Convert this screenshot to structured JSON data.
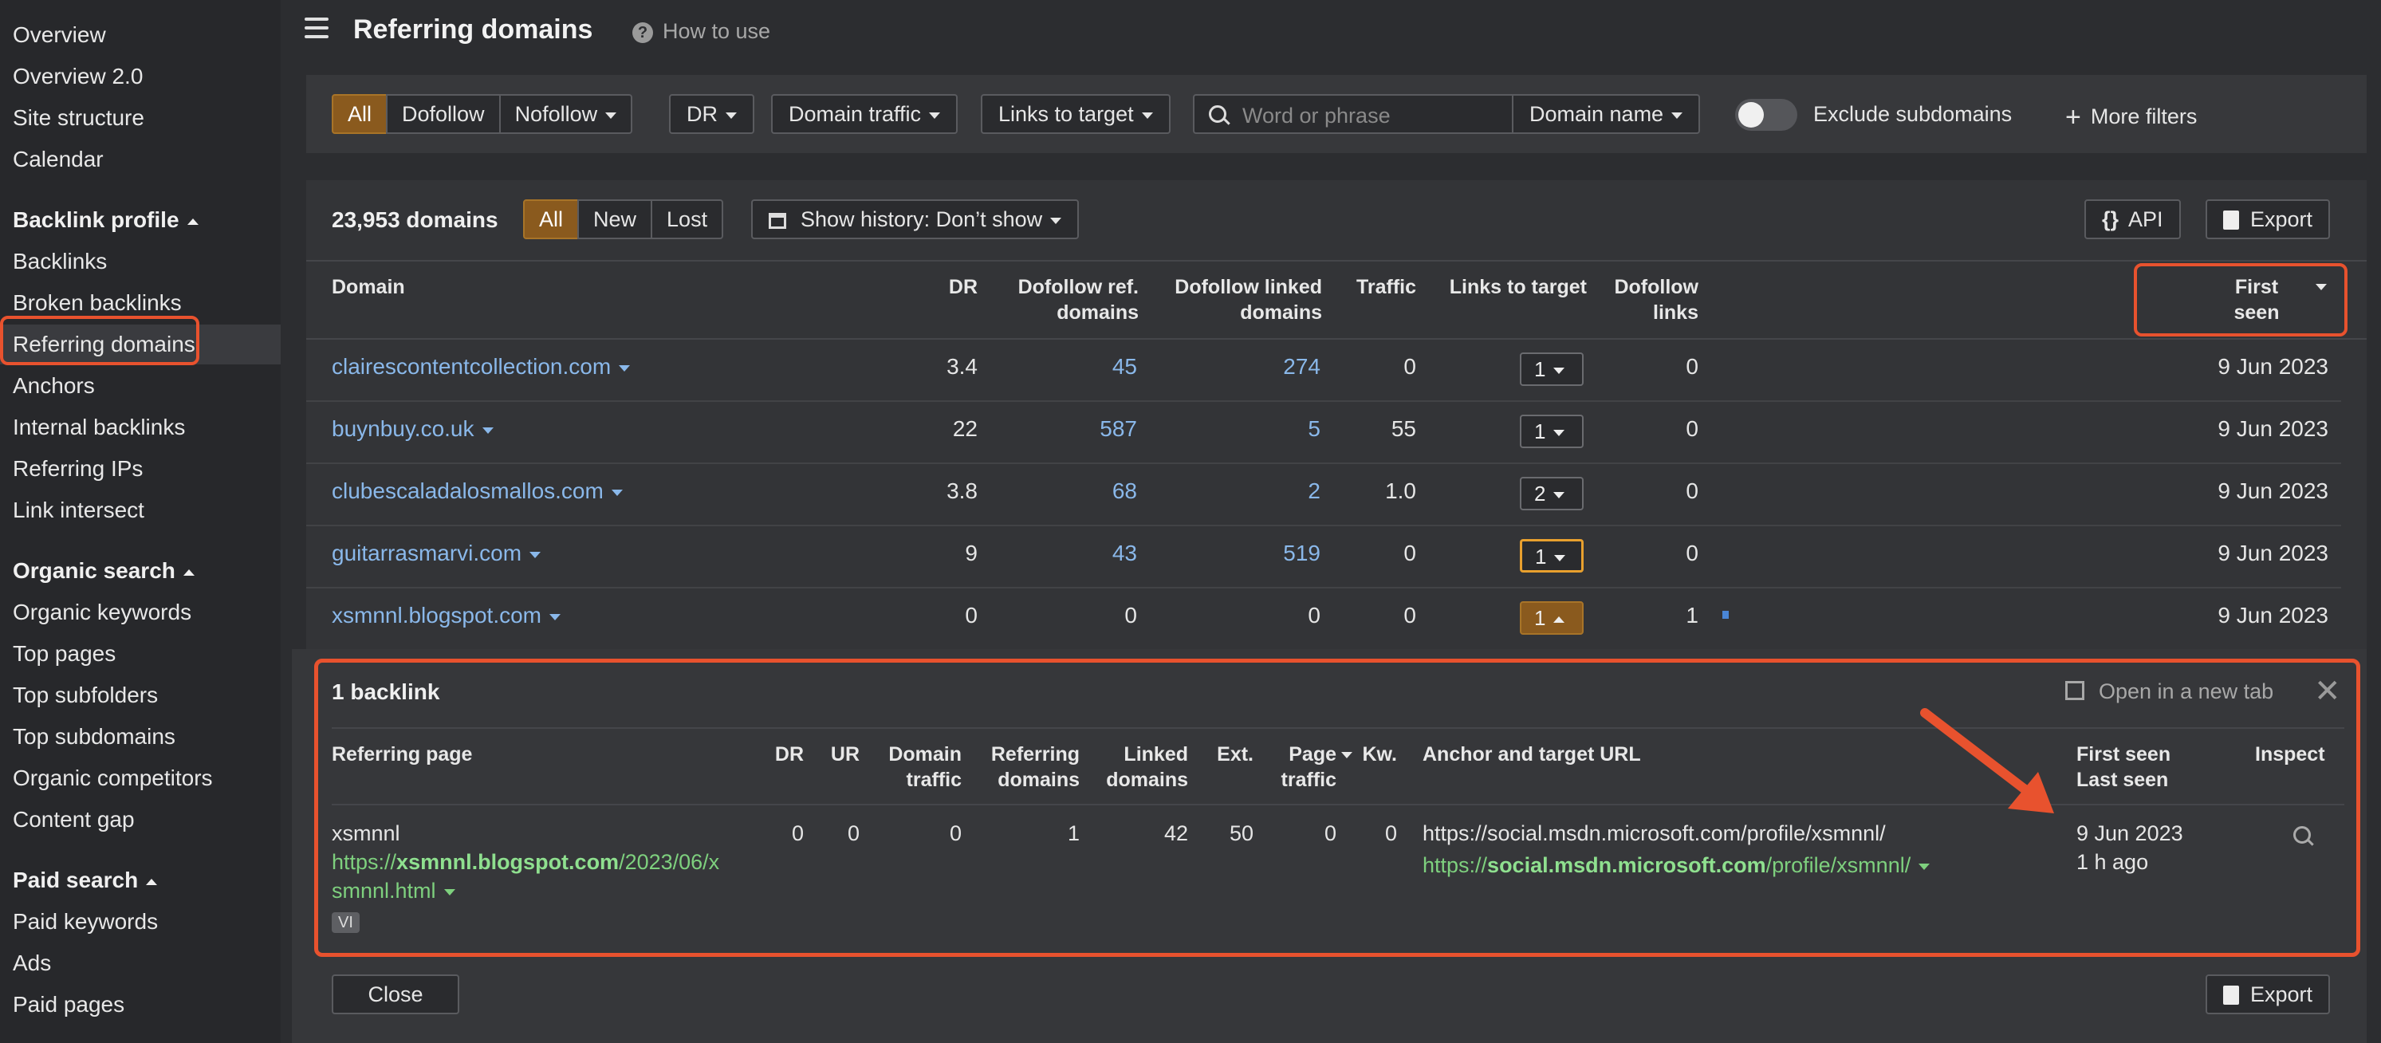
{
  "sidebar": {
    "top_items": [
      "Overview",
      "Overview 2.0",
      "Site structure",
      "Calendar"
    ],
    "sections": [
      {
        "title": "Backlink profile",
        "items": [
          "Backlinks",
          "Broken backlinks",
          "Referring domains",
          "Anchors",
          "Internal backlinks",
          "Referring IPs",
          "Link intersect"
        ]
      },
      {
        "title": "Organic search",
        "items": [
          "Organic keywords",
          "Top pages",
          "Top subfolders",
          "Top subdomains",
          "Organic competitors",
          "Content gap"
        ]
      },
      {
        "title": "Paid search",
        "items": [
          "Paid keywords",
          "Ads",
          "Paid pages"
        ]
      }
    ],
    "active_item": "Referring domains"
  },
  "header": {
    "title": "Referring domains",
    "how_to_use": "How to use"
  },
  "filters": {
    "link_types": [
      "All",
      "Dofollow",
      "Nofollow"
    ],
    "active_link_type": "All",
    "dr": "DR",
    "domain_traffic": "Domain traffic",
    "links_to_target": "Links to target",
    "search_placeholder": "Word or phrase",
    "search_scope": "Domain name",
    "exclude_subdomains": "Exclude subdomains",
    "exclude_subdomains_on": false,
    "more_filters": "More filters"
  },
  "results": {
    "count_label": "23,953 domains",
    "status_tabs": [
      "All",
      "New",
      "Lost"
    ],
    "active_status": "All",
    "history": "Show history: Don’t show",
    "api": "API",
    "export": "Export",
    "columns": {
      "domain": "Domain",
      "dr": "DR",
      "dofollow_ref_1": "Dofollow ref.",
      "dofollow_ref_2": "domains",
      "dofollow_linked_1": "Dofollow linked",
      "dofollow_linked_2": "domains",
      "traffic": "Traffic",
      "links_to_target": "Links to target",
      "dofollow_links_1": "Dofollow",
      "dofollow_links_2": "links",
      "first_seen_1": "First",
      "first_seen_2": "seen"
    },
    "rows": [
      {
        "domain": "clairescontentcollection.com",
        "dr": "3.4",
        "ref_domains": "45",
        "linked_domains": "274",
        "traffic": "0",
        "links": "1",
        "dofollow_links": "0",
        "first_seen": "9 Jun 2023"
      },
      {
        "domain": "buynbuy.co.uk",
        "dr": "22",
        "ref_domains": "587",
        "linked_domains": "5",
        "traffic": "55",
        "links": "1",
        "dofollow_links": "0",
        "first_seen": "9 Jun 2023"
      },
      {
        "domain": "clubescaladalosmallos.com",
        "dr": "3.8",
        "ref_domains": "68",
        "linked_domains": "2",
        "traffic": "1.0",
        "links": "2",
        "dofollow_links": "0",
        "first_seen": "9 Jun 2023"
      },
      {
        "domain": "guitarrasmarvi.com",
        "dr": "9",
        "ref_domains": "43",
        "linked_domains": "519",
        "traffic": "0",
        "links": "1",
        "dofollow_links": "0",
        "first_seen": "9 Jun 2023"
      },
      {
        "domain": "xsmnnl.blogspot.com",
        "dr": "0",
        "ref_domains": "0",
        "linked_domains": "0",
        "traffic": "0",
        "links": "1",
        "dofollow_links": "1",
        "first_seen": "9 Jun 2023"
      }
    ]
  },
  "backlink_panel": {
    "title": "1 backlink",
    "open_new_tab": "Open in a new tab",
    "close_glyph": "✕",
    "columns": {
      "referring_page": "Referring page",
      "dr": "DR",
      "ur": "UR",
      "domain_traffic_1": "Domain",
      "domain_traffic_2": "traffic",
      "referring_domains_1": "Referring",
      "referring_domains_2": "domains",
      "linked_domains_1": "Linked",
      "linked_domains_2": "domains",
      "ext": "Ext.",
      "page_traffic_1": "Page",
      "page_traffic_2": "traffic",
      "kw": "Kw.",
      "anchor_url": "Anchor and target URL",
      "first_seen": "First seen",
      "last_seen": "Last seen",
      "inspect": "Inspect"
    },
    "row": {
      "page_title": "xsmnnl",
      "url_prefix": "https://",
      "url_domain": "xsmnnl.blogspot.com",
      "url_path_1": "/2023/06/x",
      "url_path_2": "smnnl.html",
      "lang": "VI",
      "dr": "0",
      "ur": "0",
      "domain_traffic": "0",
      "referring_domains": "1",
      "linked_domains": "42",
      "ext": "50",
      "page_traffic": "0",
      "kw": "0",
      "anchor": "https://social.msdn.microsoft.com/profile/xsmnnl/",
      "target_prefix": "https://",
      "target_domain": "social.msdn.microsoft.com",
      "target_path": "/profile/xsmnnl/",
      "first_seen": "9 Jun 2023",
      "last_seen": "1 h ago"
    },
    "close_button": "Close",
    "export_button": "Export"
  },
  "colors": {
    "accent": "#8a5a1e",
    "highlight": "#e8522e",
    "link": "#8ab8ea",
    "url_green": "#7ed07e"
  }
}
